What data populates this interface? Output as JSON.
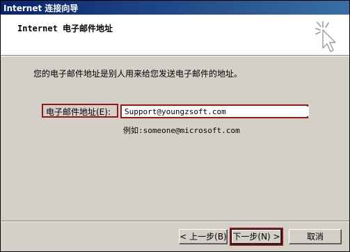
{
  "window": {
    "title": "Internet 连接向导"
  },
  "header": {
    "title": "Internet 电子邮件地址",
    "icon": "wizard-sparkle-cursor-icon"
  },
  "main": {
    "prompt": "您的电子邮件地址是别人用来给您发送电子邮件的地址。",
    "email_label": "电子邮件地址(E):",
    "email_value": "Support@youngzsoft.com",
    "example": "例如:someone@microsoft.com"
  },
  "footer": {
    "back_label": "< 上一步(B)",
    "next_label": "下一步(N) >",
    "cancel_label": "取消"
  },
  "colors": {
    "title_bar": "#0a246a",
    "face": "#d4d0c8",
    "highlight_border": "#8b1a1a"
  }
}
